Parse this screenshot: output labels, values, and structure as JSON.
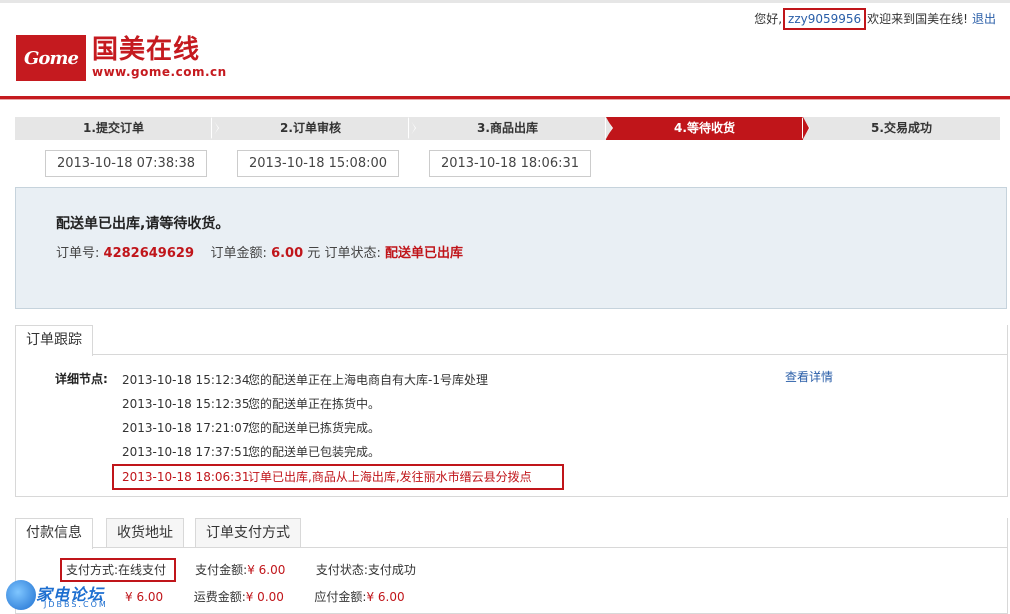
{
  "header": {
    "greeting_prefix": "您好,",
    "username": "zzy9059956",
    "greeting_suffix": "欢迎来到国美在线!",
    "logout_label": "退出",
    "logo_badge": "Gome",
    "logo_cn": "国美在线",
    "logo_url": "www.gome.com.cn",
    "accent_color": "#c51a1f"
  },
  "steps": [
    {
      "label": "1.提交订单",
      "time": "2013-10-18 07:38:38",
      "active": false
    },
    {
      "label": "2.订单审核",
      "time": "2013-10-18 15:08:00",
      "active": false
    },
    {
      "label": "3.商品出库",
      "time": "2013-10-18 18:06:31",
      "active": false
    },
    {
      "label": "4.等待收货",
      "active": true
    },
    {
      "label": "5.交易成功",
      "active": false
    }
  ],
  "status": {
    "message": "配送单已出库,请等待收货。",
    "order_no_label": "订单号:",
    "order_no": "4282649629",
    "amount_label": "订单金额:",
    "amount": "6.00",
    "amount_unit": "元",
    "state_label": "订单状态:",
    "state": "配送单已出库"
  },
  "tracking": {
    "tab_label": "订单跟踪",
    "node_label": "详细节点:",
    "detail_link": "查看详情",
    "events": [
      {
        "time": "2013-10-18 15:12:34",
        "text": "您的配送单正在上海电商自有大库-1号库处理"
      },
      {
        "time": "2013-10-18 15:12:35",
        "text": "您的配送单正在拣货中。"
      },
      {
        "time": "2013-10-18 17:21:07",
        "text": "您的配送单已拣货完成。"
      },
      {
        "time": "2013-10-18 17:37:51",
        "text": "您的配送单已包装完成。"
      },
      {
        "time": "2013-10-18 18:06:31",
        "text": "订单已出库,商品从上海出库,发往丽水市缙云县分拨点"
      }
    ]
  },
  "payment": {
    "tabs": [
      "付款信息",
      "收货地址",
      "订单支付方式"
    ],
    "method_label": "支付方式:",
    "method": "在线支付",
    "paid_label": "支付金额:",
    "paid": "¥ 6.00",
    "pay_state_label": "支付状态:",
    "pay_state": "支付成功",
    "row2_amount": "¥ 6.00",
    "shipping_label": "运费金额:",
    "shipping": "¥ 0.00",
    "due_label": "应付金额:",
    "due": "¥ 6.00"
  },
  "watermark": {
    "text": "家电论坛",
    "sub": "JDBBS.COM"
  }
}
